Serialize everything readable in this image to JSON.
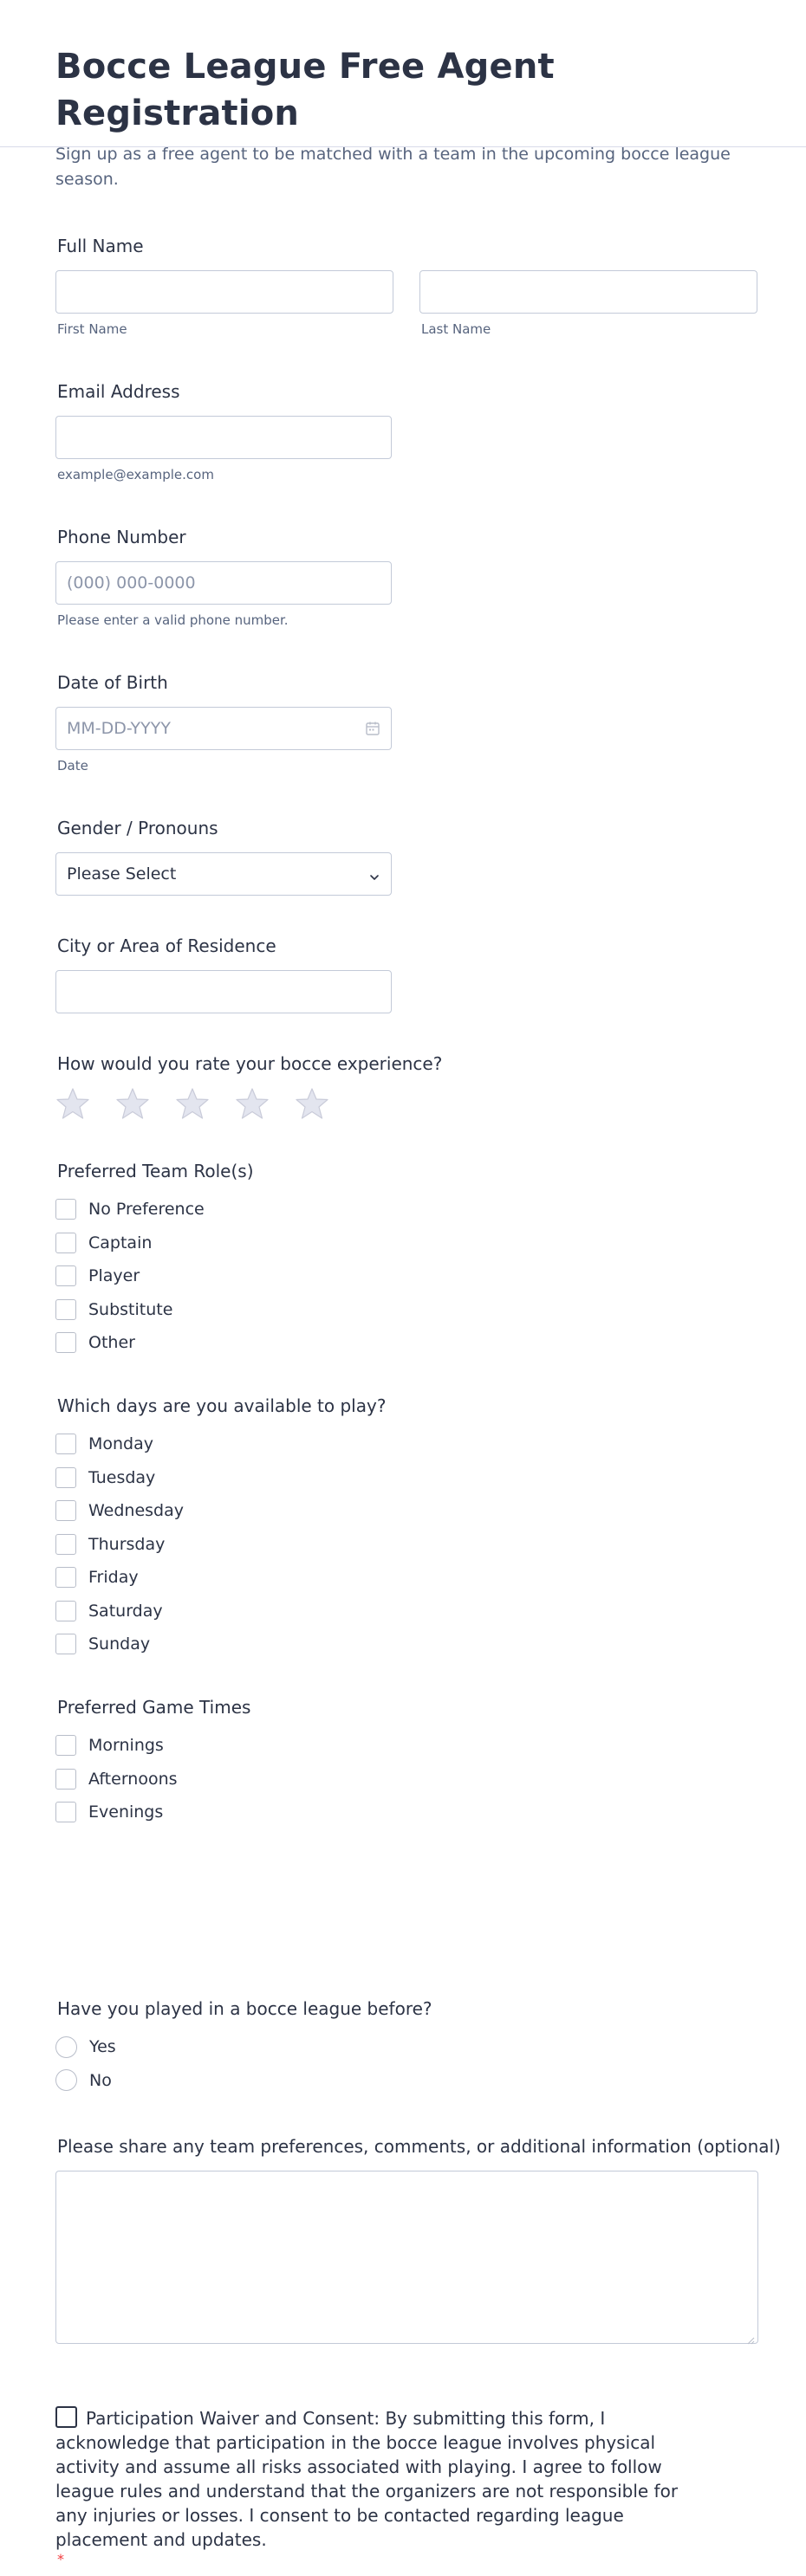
{
  "header": {
    "title": "Bocce League Free Agent Registration",
    "subtitle": "Sign up as a free agent to be matched with a team in the upcoming bocce league season."
  },
  "full_name": {
    "label": "Full Name",
    "first_sublabel": "First Name",
    "last_sublabel": "Last Name",
    "first_value": "",
    "last_value": ""
  },
  "email": {
    "label": "Email Address",
    "value": "",
    "sublabel": "example@example.com"
  },
  "phone": {
    "label": "Phone Number",
    "placeholder": "(000) 000-0000",
    "sublabel": "Please enter a valid phone number."
  },
  "dob": {
    "label": "Date of Birth",
    "placeholder": "MM-DD-YYYY",
    "sublabel": "Date",
    "icon": "calendar-icon"
  },
  "gender": {
    "label": "Gender / Pronouns",
    "selected": "Please Select",
    "icon": "chevron-down-icon"
  },
  "city": {
    "label": "City or Area of Residence",
    "value": ""
  },
  "rating": {
    "label": "How would you rate your bocce experience?",
    "max": 5,
    "value": 0,
    "star_color": "#e3e5ef",
    "star_stroke": "#c9cbd9"
  },
  "team_role": {
    "label": "Preferred Team Role(s)",
    "options": [
      "No Preference",
      "Captain",
      "Player",
      "Substitute",
      "Other"
    ]
  },
  "days": {
    "label": "Which days are you available to play?",
    "options": [
      "Monday",
      "Tuesday",
      "Wednesday",
      "Thursday",
      "Friday",
      "Saturday",
      "Sunday"
    ]
  },
  "times": {
    "label": "Preferred Game Times",
    "options": [
      "Mornings",
      "Afternoons",
      "Evenings"
    ]
  },
  "played_before": {
    "label": "Have you played in a bocce league before?",
    "options": [
      "Yes",
      "No"
    ]
  },
  "comments": {
    "label": "Please share any team preferences, comments, or additional information (optional)",
    "value": ""
  },
  "waiver": {
    "text": "Participation Waiver and Consent: By submitting this form, I acknowledge that participation in the bocce league involves physical activity and assume all risks associated with playing. I agree to follow league rules and understand that the organizers are not responsible for any injuries or losses. I consent to be contacted regarding league placement and updates.",
    "required_mark": "*",
    "required_color": "#f23a3c"
  }
}
